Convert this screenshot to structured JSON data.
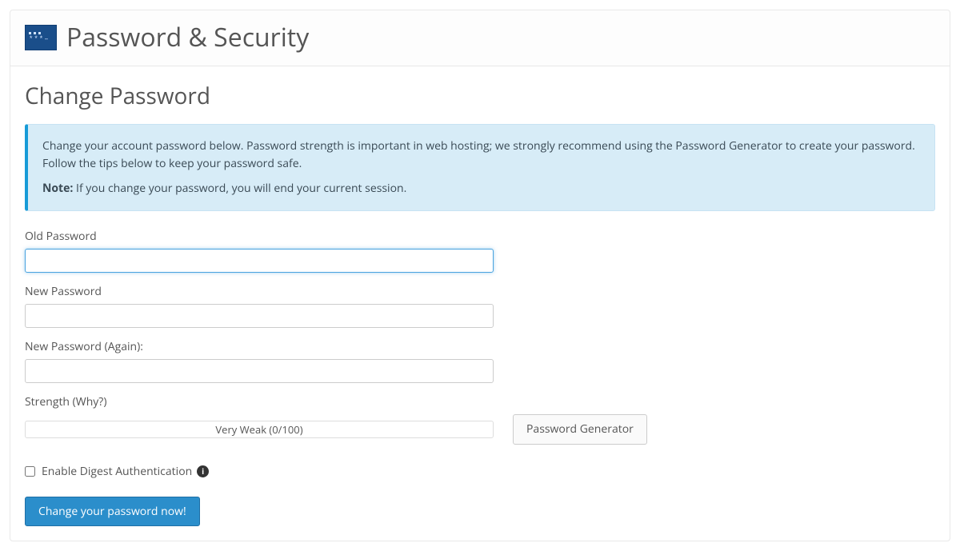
{
  "header": {
    "page_title": "Password & Security"
  },
  "section": {
    "title": "Change Password"
  },
  "callout": {
    "intro": "Change your account password below. Password strength is important in web hosting; we strongly recommend using the Password Generator to create your password. Follow the tips below to keep your password safe.",
    "note_label": "Note:",
    "note_text": " If you change your password, you will end your current session."
  },
  "fields": {
    "old_password": {
      "label": "Old Password",
      "value": ""
    },
    "new_password": {
      "label": "New Password",
      "value": ""
    },
    "new_password_again": {
      "label": "New Password (Again):",
      "value": ""
    }
  },
  "strength": {
    "label_prefix": "Strength ",
    "why_link_text": "(Why?)",
    "meter_text": "Very Weak (0/100)"
  },
  "buttons": {
    "password_generator": "Password Generator",
    "submit": "Change your password now!"
  },
  "digest": {
    "label": "Enable Digest Authentication",
    "checked": false
  }
}
